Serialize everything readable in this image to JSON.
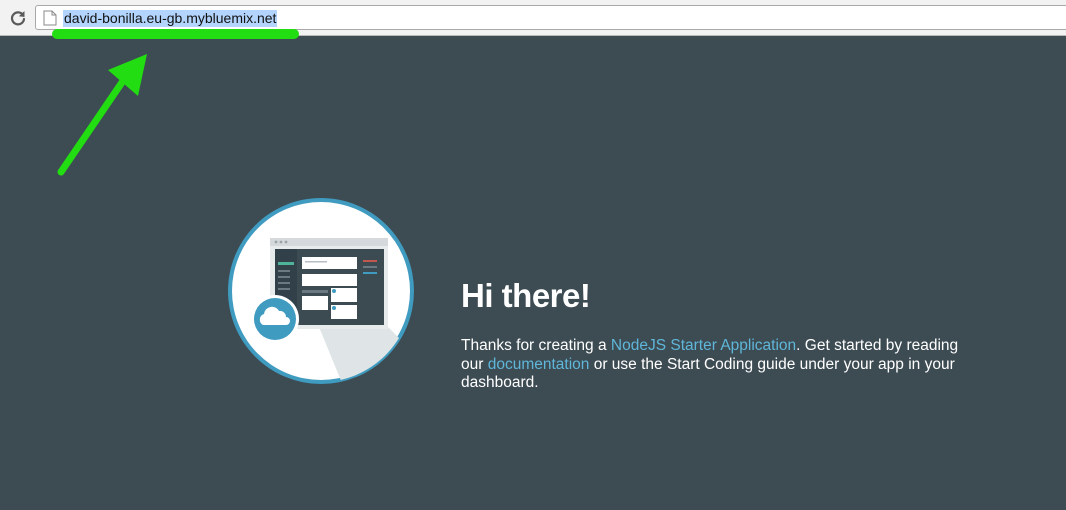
{
  "browser": {
    "url": "david-bonilla.eu-gb.mybluemix.net",
    "reload_icon": "reload-icon",
    "page_icon": "page-icon"
  },
  "annotation": {
    "highlight_color": "#22dd11",
    "arrow_color": "#22dd11"
  },
  "page": {
    "background": "#3d4b53",
    "heading": "Hi there!",
    "description": {
      "part1": "Thanks for creating a ",
      "link1": "NodeJS Starter Application",
      "part2": ". Get started by reading our ",
      "link2": "documentation",
      "part3": " or use the Start Coding guide under your app in your dashboard."
    },
    "link_color": "#5fb6d9",
    "illustration_icon": "cloud-app-illustration"
  }
}
